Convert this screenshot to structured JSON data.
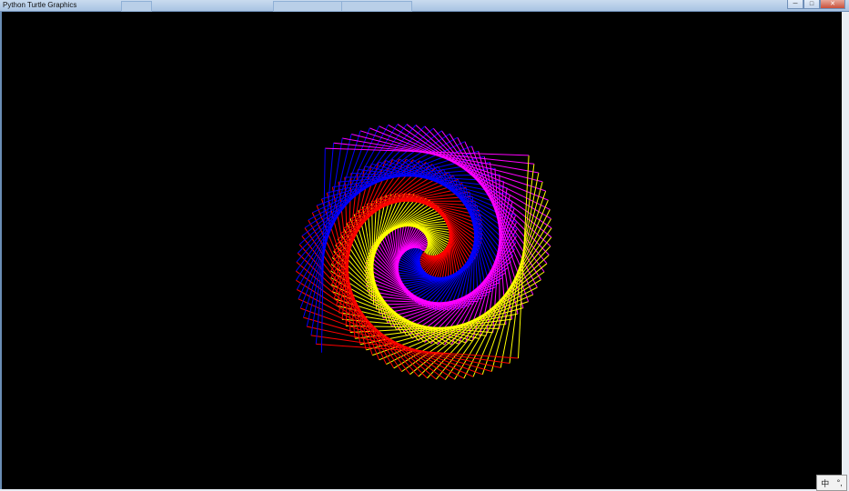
{
  "window": {
    "title": "Python Turtle Graphics",
    "ghost_tabs": [
      "",
      "",
      ""
    ],
    "controls": {
      "minimize": "─",
      "maximize": "□",
      "close": "✕"
    }
  },
  "canvas": {
    "background": "#000000",
    "drawing": "spiral-squares",
    "colors": [
      "#ff0000",
      "#ffff00",
      "#ff00ff",
      "#0000ff"
    ]
  },
  "ime": {
    "lang": "中",
    "icon": "°,"
  }
}
